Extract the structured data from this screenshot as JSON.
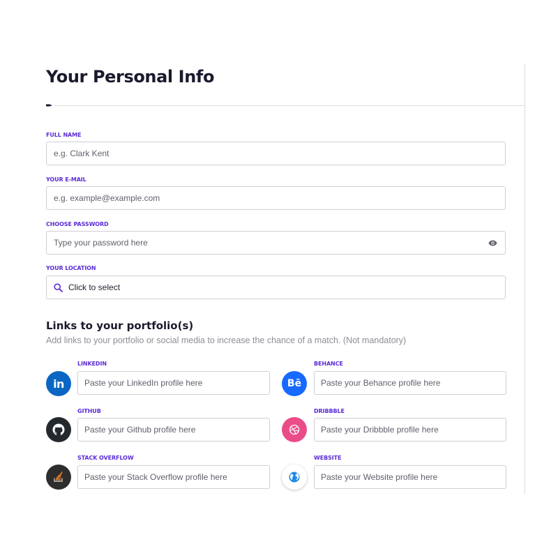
{
  "page_title": "Your Personal Info",
  "form": {
    "full_name": {
      "label": "FULL NAME",
      "placeholder": "e.g. Clark Kent"
    },
    "email": {
      "label": "YOUR E-MAIL",
      "placeholder": "e.g. example@example.com"
    },
    "password": {
      "label": "CHOOSE PASSWORD",
      "placeholder": "Type your password here",
      "icon": "eye-icon"
    },
    "location": {
      "label": "YOUR LOCATION",
      "placeholder": "Click to select",
      "icon": "search-icon"
    }
  },
  "portfolio": {
    "title": "Links to your portfolio(s)",
    "subtitle": "Add links to your portfolio or social media to increase the chance of a match. (Not mandatory)",
    "links": [
      {
        "label": "LINKEDIN",
        "placeholder": "Paste your LinkedIn profile here",
        "icon": "linkedin-icon",
        "color": "#0a66c2"
      },
      {
        "label": "BEHANCE",
        "placeholder": "Paste your Behance profile here",
        "icon": "behance-icon",
        "color": "#1769ff"
      },
      {
        "label": "GITHUB",
        "placeholder": "Paste your Github profile here",
        "icon": "github-icon",
        "color": "#24292e"
      },
      {
        "label": "DRIBBBLE",
        "placeholder": "Paste your Dribbble profile here",
        "icon": "dribbble-icon",
        "color": "#ea4c89"
      },
      {
        "label": "STACK OVERFLOW",
        "placeholder": "Paste your Stack Overflow profile here",
        "icon": "stackoverflow-icon",
        "color": "#2d2d2d"
      },
      {
        "label": "WEBSITE",
        "placeholder": "Paste your Website profile here",
        "icon": "globe-icon",
        "color": "#1e88e5"
      }
    ]
  },
  "colors": {
    "accent": "#5b2bd6",
    "border": "#cfcfd6",
    "text": "#1a1a2e",
    "muted": "#8d8d96"
  }
}
